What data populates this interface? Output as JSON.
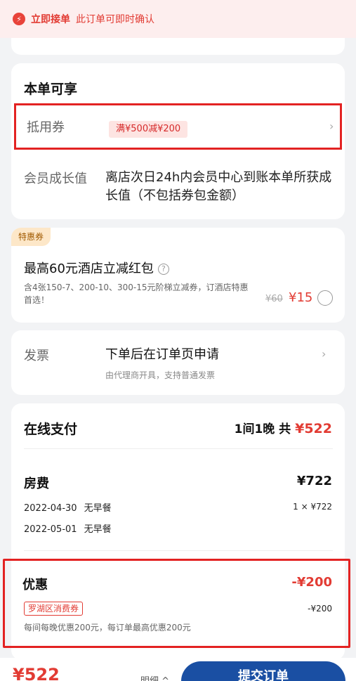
{
  "notice": {
    "icon": "lightning-icon",
    "title": "立即接单",
    "text": "此订单可即时确认"
  },
  "enjoy": {
    "title": "本单可享",
    "voucher_label": "抵用券",
    "voucher_tag": "满¥500减¥200",
    "member_label": "会员成长值",
    "member_value": "离店次日24h内会员中心到账本单所获成长值（不包括券包金额）"
  },
  "promo": {
    "badge": "特惠券",
    "title": "最高60元酒店立减红包",
    "help": "?",
    "desc": "含4张150-7、200-10、300-15元阶梯立减券，订酒店特惠首选！",
    "orig_price": "¥60",
    "price": "¥15"
  },
  "invoice": {
    "label": "发票",
    "value": "下单后在订单页申请",
    "sub": "由代理商开具，支持普通发票"
  },
  "pay": {
    "title": "在线支付",
    "summary_prefix": "1间1晚  共",
    "summary_total": "¥522",
    "room_title": "房费",
    "room_price": "¥722",
    "nights": [
      {
        "date": "2022-04-30",
        "meal": "无早餐"
      },
      {
        "date": "2022-05-01",
        "meal": "无早餐"
      }
    ],
    "qty": "1 × ¥722",
    "disc_title": "优惠",
    "disc_total": "-¥200",
    "disc_tag": "罗湖区消费券",
    "disc_amount": "-¥200",
    "disc_desc": "每间每晚优惠200元，每订单最高优惠200元"
  },
  "bottom": {
    "price": "¥522",
    "detail": "明细 ^",
    "submit": "提交订单"
  }
}
